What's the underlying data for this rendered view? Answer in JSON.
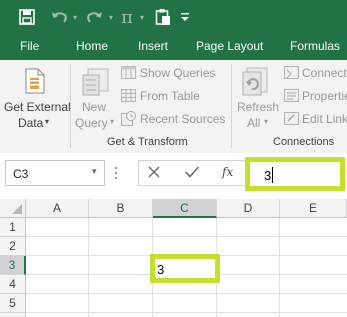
{
  "quick_access": {
    "icons": [
      "save-icon",
      "undo-icon",
      "redo-icon",
      "pi-icon",
      "paste-icon",
      "customize-dropdown-icon"
    ],
    "pi_glyph": "π"
  },
  "tabs": [
    "File",
    "Home",
    "Insert",
    "Page Layout",
    "Formulas"
  ],
  "ribbon": {
    "get_external": {
      "line1": "Get External",
      "line2": "Data"
    },
    "get_transform": {
      "new_query": {
        "line1": "New",
        "line2": "Query"
      },
      "show_queries": "Show Queries",
      "from_table": "From Table",
      "recent_sources": "Recent Sources",
      "group_label": "Get & Transform"
    },
    "connections": {
      "refresh": {
        "line1": "Refresh",
        "line2": "All"
      },
      "connections": "Connect",
      "properties": "Propertie",
      "edit_links": "Edit Link",
      "group_label": "Connections"
    }
  },
  "formula_bar": {
    "name_box": "C3",
    "fx": "fx",
    "value": "3"
  },
  "grid": {
    "columns": [
      "A",
      "B",
      "C",
      "D",
      "E"
    ],
    "rows": [
      "1",
      "2",
      "3",
      "4",
      "5"
    ],
    "active_cell_value": "3"
  },
  "colors": {
    "excel_green": "#217346",
    "highlight_lime": "#c3e02d",
    "selection_green": "#217346"
  }
}
